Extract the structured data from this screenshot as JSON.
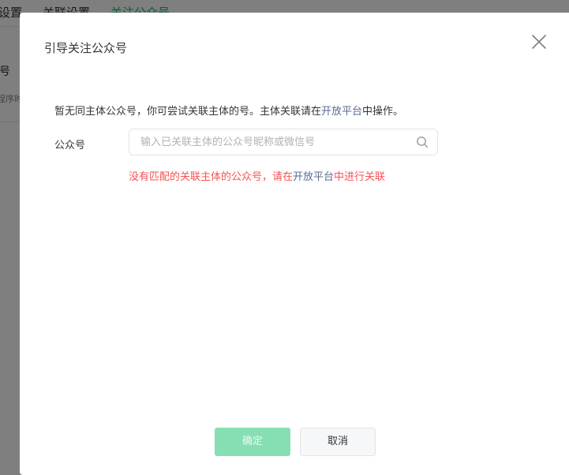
{
  "background": {
    "tabs": [
      "设置",
      "关联设置",
      "关注公众号"
    ],
    "section_title": "号",
    "section_sub": "程序时"
  },
  "dialog": {
    "title": "引导关注公众号",
    "notice_prefix": "暂无同主体公众号，你可尝试关联主体的号。主体关联请在",
    "notice_link": "开放平台",
    "notice_suffix": "中操作。",
    "field_label": "公众号",
    "search_placeholder": "输入已关联主体的公众号昵称或微信号",
    "search_value": "",
    "error_prefix": "没有匹配的关联主体的公众号，请在",
    "error_link": "开放平台",
    "error_suffix": "中进行关联",
    "confirm_label": "确定",
    "cancel_label": "取消"
  },
  "colors": {
    "accent": "#07c160",
    "link": "#576b95",
    "error": "#fa5151",
    "confirm_disabled_bg": "#86dfb3"
  }
}
